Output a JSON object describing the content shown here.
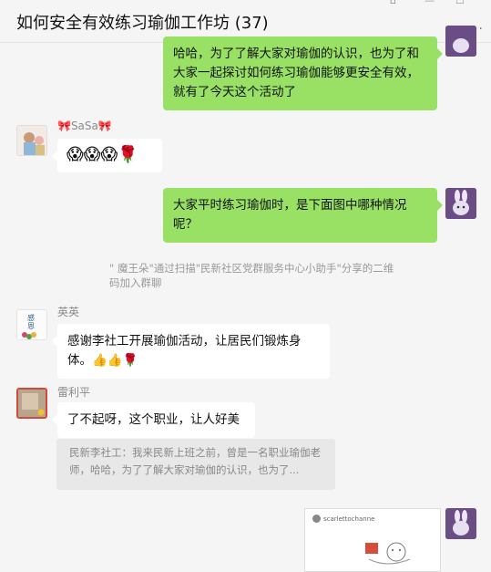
{
  "window": {
    "title": "如何安全有效练习瑜伽工作坊 (37)",
    "more_label": "..."
  },
  "messages": [
    {
      "id": "m1",
      "side": "right",
      "text": "哈哈，为了了解大家对瑜伽的认识，也为了和大家一起探讨如何练习瑜伽能够更安全有效，就有了今天这个活动了"
    },
    {
      "id": "m2",
      "side": "left",
      "sender": "🎀SaSa🎀",
      "text": "😱😱😱🌹"
    },
    {
      "id": "m3",
      "side": "right",
      "text": "大家平时练习瑜伽时，是下面图中哪种情况呢？"
    },
    {
      "id": "m4",
      "type": "system",
      "text": "\" 魔王朵\"通过扫描\"民新社区党群服务中心小助手\"分享的二维码加入群聊"
    },
    {
      "id": "m5",
      "side": "left",
      "sender": "英英",
      "text": "感谢李社工开展瑜伽活动，让居民们锻炼身体。👍👍🌹",
      "avatar_text": "感恩"
    },
    {
      "id": "m6",
      "side": "left",
      "sender": "雷利平",
      "text": "了不起呀，这个职业，让人好美",
      "quote": "民新李社工：我来民新上班之前，曾是一名职业瑜伽老师，哈哈，为了了解大家对瑜伽的认识，也为了..."
    },
    {
      "id": "m7",
      "side": "right",
      "type": "image",
      "image_username": "scarlettochanne"
    }
  ],
  "colors": {
    "self_bubble": "#98e165",
    "other_bubble": "#ffffff",
    "background": "#f5f5f5"
  }
}
